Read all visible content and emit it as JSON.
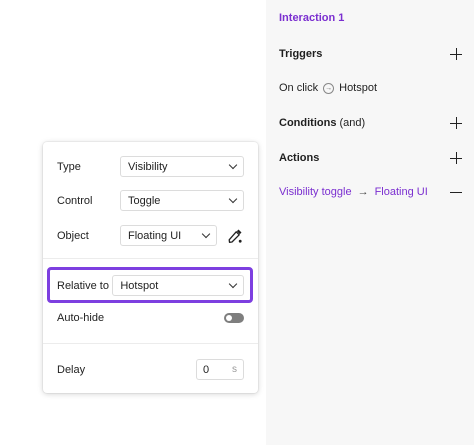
{
  "side_panel": {
    "title": "Interaction 1",
    "triggers": {
      "heading": "Triggers",
      "item": {
        "event": "On click",
        "target": "Hotspot"
      }
    },
    "conditions": {
      "heading": "Conditions",
      "sub": "(and)"
    },
    "actions": {
      "heading": "Actions",
      "item": {
        "action": "Visibility toggle",
        "arrow": "→",
        "target": "Floating UI"
      }
    }
  },
  "popup": {
    "type": {
      "label": "Type",
      "value": "Visibility"
    },
    "control": {
      "label": "Control",
      "value": "Toggle"
    },
    "object": {
      "label": "Object",
      "value": "Floating UI"
    },
    "relative_to": {
      "label": "Relative to",
      "value": "Hotspot"
    },
    "auto_hide": {
      "label": "Auto-hide",
      "enabled": false
    },
    "delay": {
      "label": "Delay",
      "value": "0",
      "unit": "s"
    }
  },
  "colors": {
    "accent": "#7b2fd0",
    "highlight": "#7d3fe0"
  },
  "icons": [
    "plus-icon",
    "minus-icon",
    "enter-icon",
    "arrow-right-icon",
    "chevron-down-icon",
    "eyedropper-icon"
  ]
}
